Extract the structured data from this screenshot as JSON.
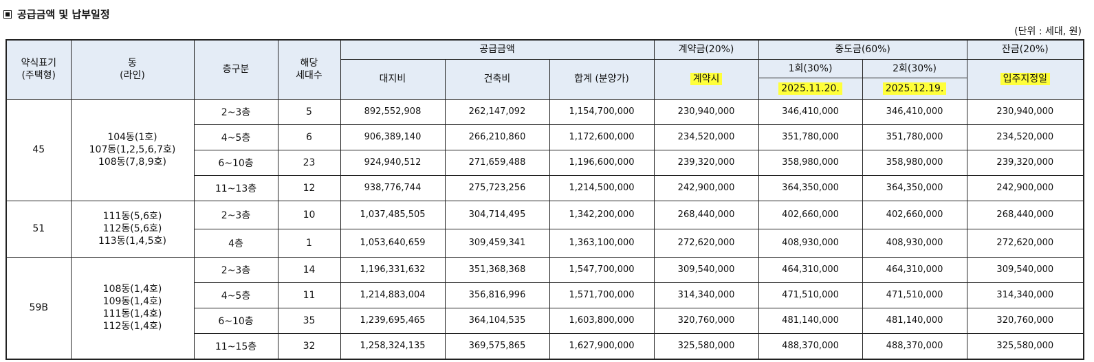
{
  "title": "공급금액 및 납부일정",
  "unit": "(단위 : 세대, 원)",
  "headers": {
    "type": "약식표기",
    "type_sub": "(주택형)",
    "dong": "동",
    "dong_sub": "(라인)",
    "floor": "층구분",
    "households": "해당",
    "households_sub": "세대수",
    "supply": "공급금액",
    "land": "대지비",
    "building": "건축비",
    "total": "합계 (분양가)",
    "deposit": "계약금(20%)",
    "deposit_when": "계약시",
    "middle": "중도금(60%)",
    "middle1": "1회(30%)",
    "middle1_date": "2025.11.20.",
    "middle2": "2회(30%)",
    "middle2_date": "2025.12.19.",
    "balance": "잔금(20%)",
    "balance_when": "입주지정일"
  },
  "groups": [
    {
      "type": "45",
      "dongs": [
        "104동(1호)",
        "107동(1,2,5,6,7호)",
        "108동(7,8,9호)"
      ],
      "rows": [
        {
          "floor": "2~3층",
          "count": "5",
          "land": "892,552,908",
          "building": "262,147,092",
          "total": "1,154,700,000",
          "deposit": "230,940,000",
          "mid1": "346,410,000",
          "mid2": "346,410,000",
          "balance": "230,940,000"
        },
        {
          "floor": "4~5층",
          "count": "6",
          "land": "906,389,140",
          "building": "266,210,860",
          "total": "1,172,600,000",
          "deposit": "234,520,000",
          "mid1": "351,780,000",
          "mid2": "351,780,000",
          "balance": "234,520,000"
        },
        {
          "floor": "6~10층",
          "count": "23",
          "land": "924,940,512",
          "building": "271,659,488",
          "total": "1,196,600,000",
          "deposit": "239,320,000",
          "mid1": "358,980,000",
          "mid2": "358,980,000",
          "balance": "239,320,000"
        },
        {
          "floor": "11~13층",
          "count": "12",
          "land": "938,776,744",
          "building": "275,723,256",
          "total": "1,214,500,000",
          "deposit": "242,900,000",
          "mid1": "364,350,000",
          "mid2": "364,350,000",
          "balance": "242,900,000"
        }
      ]
    },
    {
      "type": "51",
      "dongs": [
        "111동(5,6호)",
        "112동(5,6호)",
        "113동(1,4,5호)"
      ],
      "rows": [
        {
          "floor": "2~3층",
          "count": "10",
          "land": "1,037,485,505",
          "building": "304,714,495",
          "total": "1,342,200,000",
          "deposit": "268,440,000",
          "mid1": "402,660,000",
          "mid2": "402,660,000",
          "balance": "268,440,000"
        },
        {
          "floor": "4층",
          "count": "1",
          "land": "1,053,640,659",
          "building": "309,459,341",
          "total": "1,363,100,000",
          "deposit": "272,620,000",
          "mid1": "408,930,000",
          "mid2": "408,930,000",
          "balance": "272,620,000"
        }
      ]
    },
    {
      "type": "59B",
      "dongs": [
        "108동(1,4호)",
        "109동(1,4호)",
        "111동(1,4호)",
        "112동(1,4호)"
      ],
      "rows": [
        {
          "floor": "2~3층",
          "count": "14",
          "land": "1,196,331,632",
          "building": "351,368,368",
          "total": "1,547,700,000",
          "deposit": "309,540,000",
          "mid1": "464,310,000",
          "mid2": "464,310,000",
          "balance": "309,540,000"
        },
        {
          "floor": "4~5층",
          "count": "11",
          "land": "1,214,883,004",
          "building": "356,816,996",
          "total": "1,571,700,000",
          "deposit": "314,340,000",
          "mid1": "471,510,000",
          "mid2": "471,510,000",
          "balance": "314,340,000"
        },
        {
          "floor": "6~10층",
          "count": "35",
          "land": "1,239,695,465",
          "building": "364,104,535",
          "total": "1,603,800,000",
          "deposit": "320,760,000",
          "mid1": "481,140,000",
          "mid2": "481,140,000",
          "balance": "320,760,000"
        },
        {
          "floor": "11~15층",
          "count": "32",
          "land": "1,258,324,135",
          "building": "369,575,865",
          "total": "1,627,900,000",
          "deposit": "325,580,000",
          "mid1": "488,370,000",
          "mid2": "488,370,000",
          "balance": "325,580,000"
        }
      ]
    }
  ]
}
